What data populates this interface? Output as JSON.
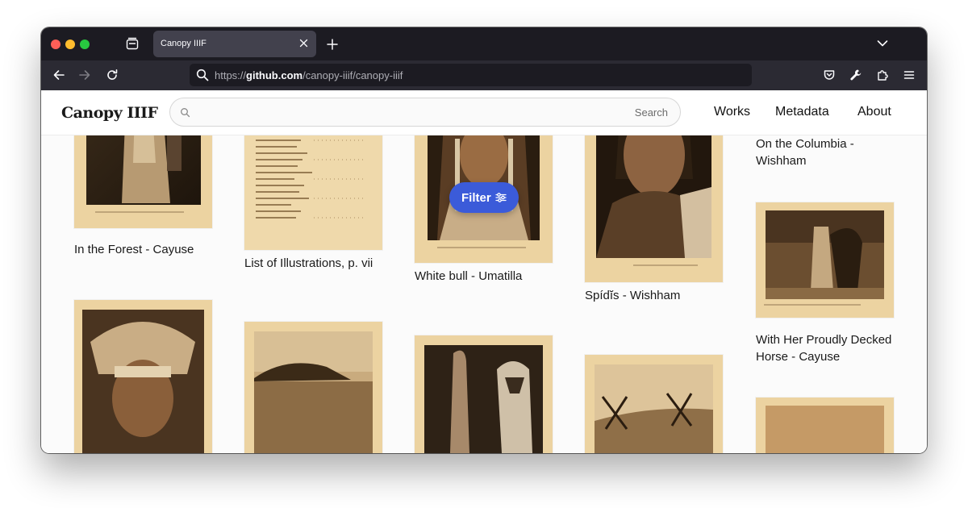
{
  "browser": {
    "tab_title": "Canopy IIIF",
    "url_prefix": "https://",
    "url_domain": "github.com",
    "url_path": "/canopy-iiif/canopy-iiif"
  },
  "site": {
    "logo": "Canopy IIIF",
    "search_button": "Search",
    "search_placeholder": "",
    "nav": [
      "Works",
      "Metadata",
      "About"
    ],
    "filter_label": "Filter",
    "accent_color": "#3b5bd9"
  },
  "works": [
    {
      "title": "In the Forest - Cayuse"
    },
    {
      "title": "List of Illustrations, p. vii"
    },
    {
      "title": "White bull - Umatilla"
    },
    {
      "title": "Spídĭs - Wishham"
    },
    {
      "title": "On the Columbia - Wishham"
    },
    {
      "title": "With Her Proudly Decked Horse - Cayuse"
    }
  ],
  "icons": {
    "back": "arrow-left-icon",
    "forward": "arrow-right-icon",
    "reload": "reload-icon",
    "pocket": "pocket-icon",
    "tools": "wrench-icon",
    "extensions": "puzzle-icon",
    "menu": "hamburger-icon",
    "search": "search-icon",
    "filter": "sliders-icon"
  }
}
